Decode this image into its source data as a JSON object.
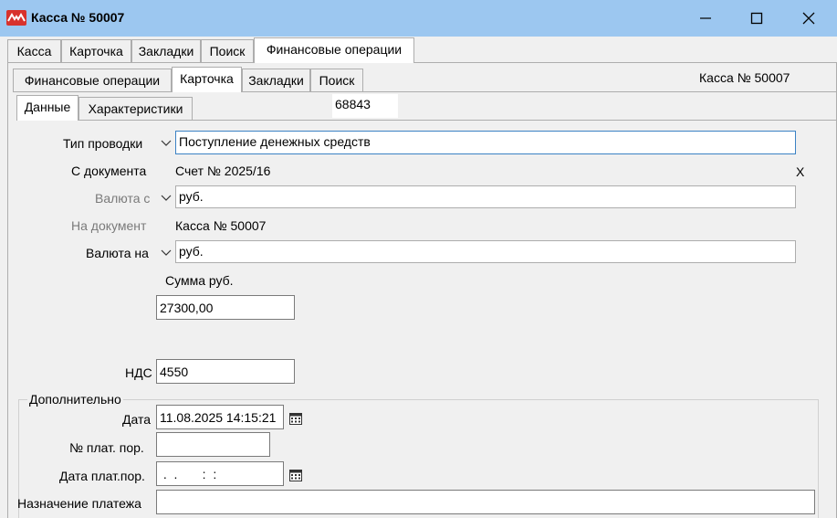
{
  "window": {
    "title": "Касса № 50007",
    "icon": "app-logo-icon",
    "controls": [
      "minimize-icon",
      "maximize-icon",
      "close-icon"
    ]
  },
  "top_tabs": [
    {
      "label": "Касса"
    },
    {
      "label": "Карточка"
    },
    {
      "label": "Закладки"
    },
    {
      "label": "Поиск"
    },
    {
      "label": "Финансовые операции",
      "active": true
    }
  ],
  "inner_tabs": [
    {
      "label": "Финансовые операции"
    },
    {
      "label": "Карточка",
      "active": true
    },
    {
      "label": "Закладки"
    },
    {
      "label": "Поиск"
    }
  ],
  "header_caption": "Касса № 50007",
  "sub_tabs": [
    {
      "label": "Данные",
      "active": true
    },
    {
      "label": "Характеристики"
    }
  ],
  "record_number": "68843",
  "form": {
    "type_label": "Тип проводки",
    "type_value": "Поступление денежных средств",
    "from_doc_label": "С документа",
    "from_doc_value": "Счет № 2025/16",
    "clear_mark": "X",
    "currency_from_label": "Валюта с",
    "currency_from_value": "руб.",
    "to_doc_label": "На документ",
    "to_doc_value": "Касса № 50007",
    "currency_to_label": "Валюта на",
    "currency_to_value": "руб.",
    "sum_label": "Сумма руб.",
    "sum_value": "27300,00",
    "vat_label": "НДС",
    "vat_value": "4550"
  },
  "additional": {
    "title": "Дополнительно",
    "date_label": "Дата",
    "date_value": "11.08.2025 14:15:21",
    "pay_order_no_label": "№ плат. пор.",
    "pay_order_no_value": "",
    "pay_order_date_label": "Дата плат.пор.",
    "pay_order_date_value": " .  .       :  :",
    "purpose_label": "Назначение платежа",
    "purpose_value": ""
  },
  "colors": {
    "titlebar": "#9cc7f0",
    "app_icon": "#d8322c",
    "focus_border": "#3b82c4"
  }
}
